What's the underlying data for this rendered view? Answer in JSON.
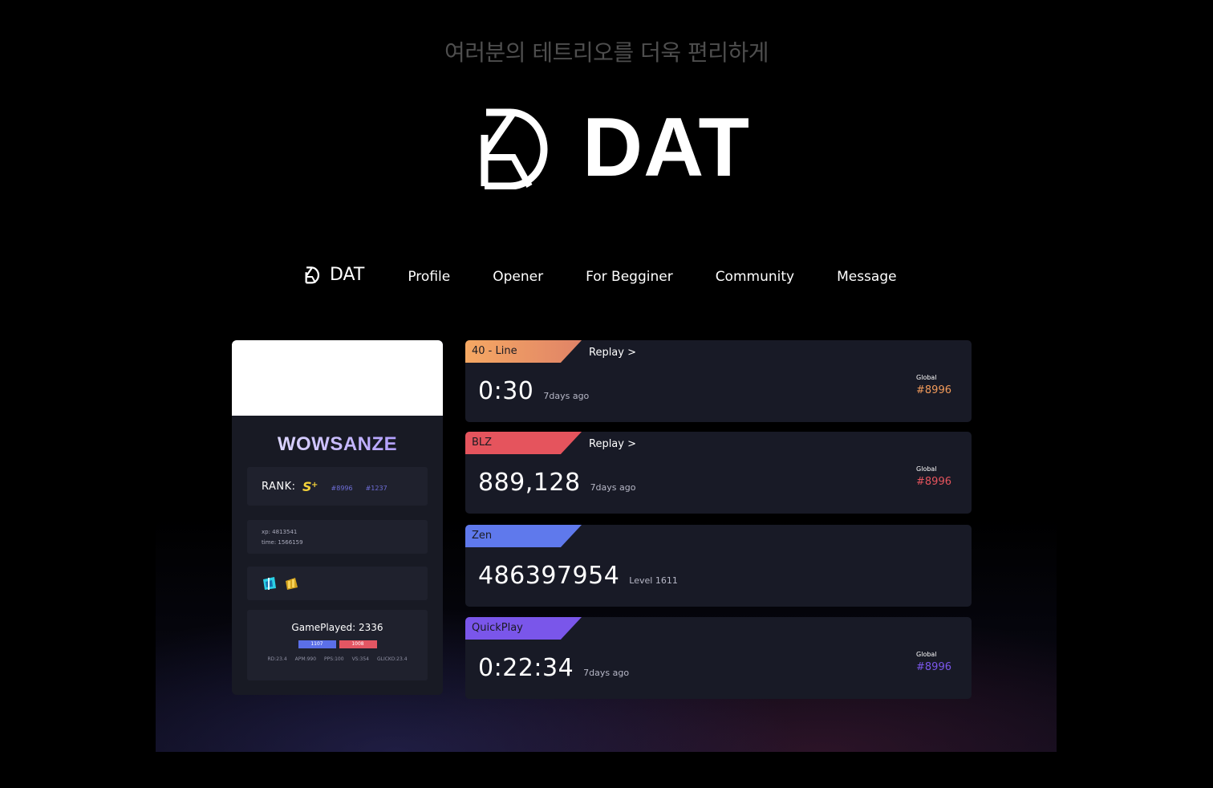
{
  "hero": {
    "tagline": "여러분의 테트리오를 더욱 편리하게",
    "title": "DAT"
  },
  "nav": {
    "brand": "DAT",
    "items": [
      "Profile",
      "Opener",
      "For Begginer",
      "Community",
      "Message"
    ]
  },
  "profile": {
    "username": "WOWSANZE",
    "rank_label": "RANK:",
    "global_rank": "#8996",
    "local_rank": "#1237",
    "xp": "xp: 4813541",
    "time": "time: 1566159",
    "games_played": "GamePlayed: 2336",
    "wins": "1107",
    "losses": "1008",
    "stats": [
      "RD:23.4",
      "APM:990",
      "PPS:100",
      "VS:354",
      "GLICKO:23.4"
    ]
  },
  "records": [
    {
      "mode": "40 - Line",
      "replay": "Replay >",
      "value": "0:30",
      "sub": "7days ago",
      "global_label": "Global",
      "global_rank": "#8996",
      "color": "#f19a5a",
      "color2": "#e1816a"
    },
    {
      "mode": "BLZ",
      "replay": "Replay >",
      "value": "889,128",
      "sub": "7days ago",
      "global_label": "Global",
      "global_rank": "#8996",
      "color": "#e5545d",
      "color2": "#e5545d"
    },
    {
      "mode": "Zen",
      "value": "486397954",
      "sub": "Level 1611",
      "color": "#5f79ec",
      "color2": "#5f79ec"
    },
    {
      "mode": "QuickPlay",
      "value": "0:22:34",
      "sub": "7days ago",
      "global_label": "Global",
      "global_rank": "#8996",
      "color": "#7a56ea",
      "color2": "#7a56ea"
    }
  ],
  "colors": {
    "background": "#000000",
    "card": "#181a26",
    "accent_orange": "#f19a5a",
    "accent_red": "#e5545d",
    "accent_blue": "#5f79ec",
    "accent_purple": "#7a56ea"
  },
  "icons": [
    "dat-logo-icon",
    "rank-badge-icon",
    "badge-blue-icon",
    "badge-gold-icon",
    "chevron-right-icon"
  ]
}
